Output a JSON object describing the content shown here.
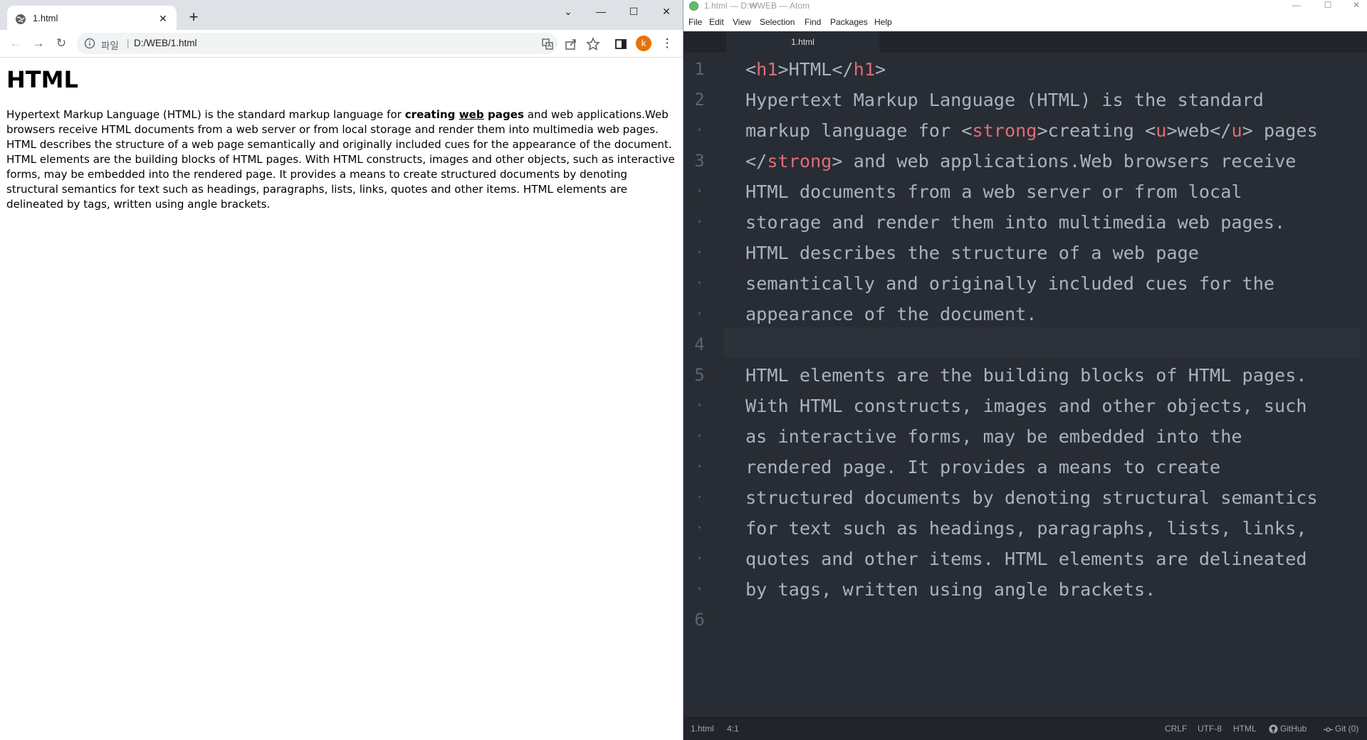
{
  "browser": {
    "tab": {
      "title": "1.html",
      "close": "✕"
    },
    "new_tab": "+",
    "window_controls": [
      "⌄",
      "—",
      "☐",
      "✕"
    ],
    "nav": {
      "back": "←",
      "forward": "→",
      "reload": "↻"
    },
    "omnibox": {
      "scheme_label": "파일",
      "separator": "|",
      "url": "D:/WEB/1.html"
    },
    "profile_initial": "k",
    "menu": "⋮",
    "page": {
      "heading": "HTML",
      "para_before": "Hypertext Markup Language (HTML) is the standard markup language for ",
      "strong_1": "creating ",
      "underline": "web",
      "strong_2": " pages",
      "para_after": " and web applications.Web browsers receive HTML documents from a web server or from local storage and render them into multimedia web pages. HTML describes the structure of a web page semantically and originally included cues for the appearance of the document. HTML elements are the building blocks of HTML pages. With HTML constructs, images and other objects, such as interactive forms, may be embedded into the rendered page. It provides a means to create structured documents by denoting structural semantics for text such as headings, paragraphs, lists, links, quotes and other items. HTML elements are delineated by tags, written using angle brackets."
    }
  },
  "editor": {
    "window_title": "1.html — D:₩WEB — Atom",
    "window_controls": [
      "—",
      "☐",
      "✕"
    ],
    "menu": [
      "File",
      "Edit",
      "View",
      "Selection",
      "Find",
      "Packages",
      "Help"
    ],
    "tab": "1.html",
    "line_numbers": [
      "1",
      "2",
      "•",
      "3",
      "•",
      "•",
      "•",
      "•",
      "•",
      "4",
      "5",
      "•",
      "•",
      "•",
      "•",
      "•",
      "•",
      "•",
      "6"
    ],
    "lines": [
      {
        "a": "<",
        "b": "h1",
        "c": ">HTML</",
        "d": "h1",
        "e": ">"
      },
      {
        "a": "Hypertext Markup Language (HTML) is the standard"
      },
      {
        "a": "markup language for <",
        "b": "strong",
        "c": ">creating <",
        "d": "u",
        "e": ">web</",
        "f": "u",
        "g": "> pages"
      },
      {
        "a": "</",
        "b": "strong",
        "c": "> and web applications.Web browsers receive"
      },
      {
        "a": "HTML documents from a web server or from local"
      },
      {
        "a": "storage and render them into multimedia web pages."
      },
      {
        "a": "HTML describes the structure of a web page"
      },
      {
        "a": "semantically and originally included cues for the"
      },
      {
        "a": "appearance of the document."
      },
      {
        "a": ""
      },
      {
        "a": "HTML elements are the building blocks of HTML pages."
      },
      {
        "a": "With HTML constructs, images and other objects, such"
      },
      {
        "a": "as interactive forms, may be embedded into the"
      },
      {
        "a": "rendered page. It provides a means to create"
      },
      {
        "a": "structured documents by denoting structural semantics"
      },
      {
        "a": "for text such as headings, paragraphs, lists, links,"
      },
      {
        "a": "quotes and other items. HTML elements are delineated"
      },
      {
        "a": "by tags, written using angle brackets."
      },
      {
        "a": ""
      }
    ],
    "status": {
      "file": "1.html",
      "cursor": "4:1",
      "line_ending": "CRLF",
      "encoding": "UTF-8",
      "grammar": "HTML",
      "github": "GitHub",
      "git": "Git (0)"
    }
  },
  "colors": {
    "tag": "#e06c75",
    "editor_bg": "#282c34",
    "editor_text": "#abb2bf",
    "profile": "#e8710a"
  },
  "icons": {
    "favicon": "globe-icon",
    "info": "info-icon",
    "translate": "translate-icon",
    "share": "share-icon",
    "bookmark": "star-icon",
    "side_panel": "side-panel-icon",
    "github": "github-icon",
    "git": "git-commit-icon"
  }
}
